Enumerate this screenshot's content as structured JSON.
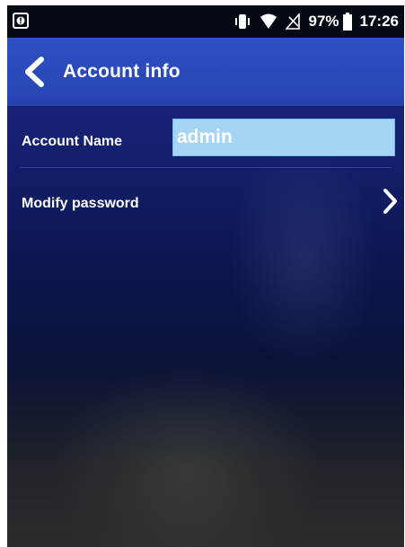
{
  "status_bar": {
    "battery_percent": "97%",
    "time": "17:26",
    "icons": [
      "notification-icon",
      "vibrate-icon",
      "wifi-icon",
      "no-signal-icon",
      "battery-icon"
    ]
  },
  "app_bar": {
    "title": "Account info",
    "back_icon": "chevron-left-icon"
  },
  "account": {
    "label": "Account Name",
    "value": "admin"
  },
  "password": {
    "label": "Modify password",
    "chevron_icon": "chevron-right-icon"
  },
  "colors": {
    "app_bar": "#2a48b8",
    "background": "#0d1650",
    "input_fill": "#a6d4f5",
    "text": "#ffffff"
  }
}
